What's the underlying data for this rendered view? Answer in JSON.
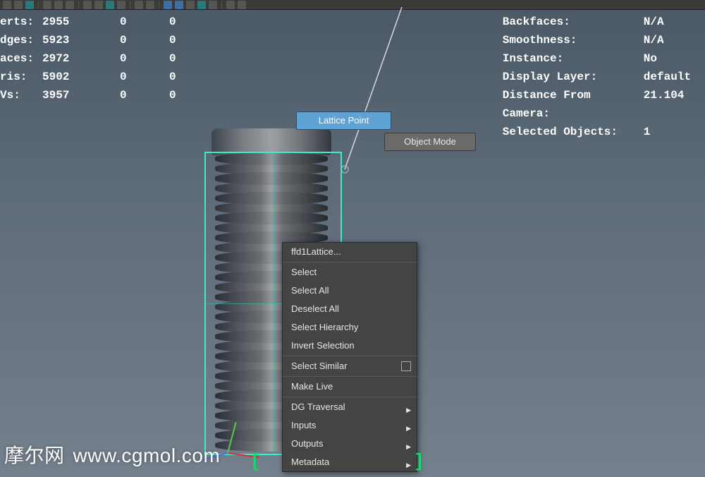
{
  "stats_left": [
    {
      "label": "erts:",
      "c1": "2955",
      "c2": "0",
      "c3": "0"
    },
    {
      "label": "dges:",
      "c1": "5923",
      "c2": "0",
      "c3": "0"
    },
    {
      "label": "aces:",
      "c1": "2972",
      "c2": "0",
      "c3": "0"
    },
    {
      "label": "ris:",
      "c1": "5902",
      "c2": "0",
      "c3": "0"
    },
    {
      "label": "Vs:",
      "c1": "3957",
      "c2": "0",
      "c3": "0"
    }
  ],
  "stats_right": [
    {
      "label": "Backfaces:",
      "value": "N/A"
    },
    {
      "label": "Smoothness:",
      "value": "N/A"
    },
    {
      "label": "Instance:",
      "value": "No"
    },
    {
      "label": "Display Layer:",
      "value": "default"
    },
    {
      "label": "Distance From Camera:",
      "value": "21.104"
    },
    {
      "label": "Selected Objects:",
      "value": "1"
    }
  ],
  "buttons": {
    "lattice_point": "Lattice Point",
    "object_mode": "Object Mode"
  },
  "context_menu": {
    "items": [
      {
        "label": "ffd1Lattice...",
        "kind": "plain"
      },
      {
        "label": "divider"
      },
      {
        "label": "Select",
        "kind": "plain"
      },
      {
        "label": "Select All",
        "kind": "plain"
      },
      {
        "label": "Deselect All",
        "kind": "plain"
      },
      {
        "label": "Select Hierarchy",
        "kind": "plain"
      },
      {
        "label": "Invert Selection",
        "kind": "plain"
      },
      {
        "label": "divider"
      },
      {
        "label": "Select Similar",
        "kind": "checkbox"
      },
      {
        "label": "divider"
      },
      {
        "label": "Make Live",
        "kind": "plain"
      },
      {
        "label": "divider"
      },
      {
        "label": "DG Traversal",
        "kind": "submenu"
      },
      {
        "label": "Inputs",
        "kind": "submenu"
      },
      {
        "label": "Outputs",
        "kind": "submenu"
      },
      {
        "label": "Metadata",
        "kind": "submenu"
      }
    ]
  },
  "watermark": {
    "cn": "摩尔网",
    "url": "www.cgmol.com"
  }
}
